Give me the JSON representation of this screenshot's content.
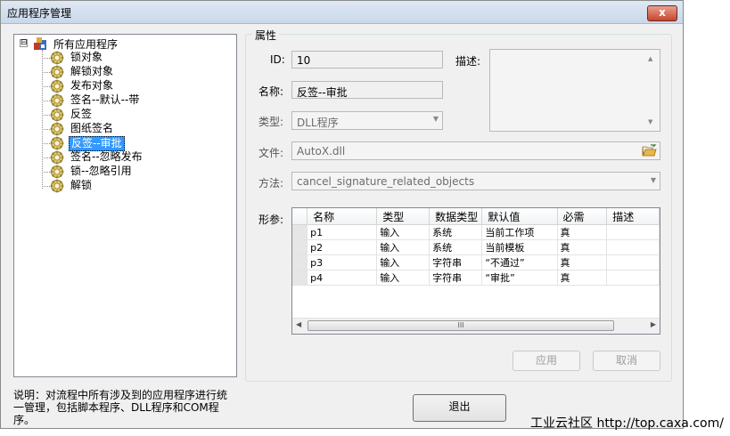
{
  "window": {
    "title": "应用程序管理",
    "close_label": "x"
  },
  "tree": {
    "expander": "⊟",
    "root_label": "所有应用程序",
    "items": [
      {
        "label": "锁对象"
      },
      {
        "label": "解锁对象"
      },
      {
        "label": "发布对象"
      },
      {
        "label": "签名--默认--带"
      },
      {
        "label": "反签"
      },
      {
        "label": "图纸签名"
      },
      {
        "label": "反签--审批",
        "selected": true
      },
      {
        "label": "签名--忽略发布"
      },
      {
        "label": "锁--忽略引用"
      },
      {
        "label": "解锁"
      }
    ]
  },
  "note": "说明：对流程中所有涉及到的应用程序进行统一管理，包括脚本程序、DLL程序和COM程序。",
  "properties": {
    "group_title": "属性",
    "id_label": "ID:",
    "id_value": "10",
    "desc_label": "描述:",
    "desc_value": "",
    "name_label": "名称:",
    "name_value": "反签--审批",
    "type_label": "类型:",
    "type_value": "DLL程序",
    "file_label": "文件:",
    "file_value": "AutoX.dll",
    "method_label": "方法:",
    "method_value": "cancel_signature_related_objects",
    "params_label": "形参:"
  },
  "params_table": {
    "columns": [
      "名称",
      "类型",
      "数据类型",
      "默认值",
      "必需",
      "描述"
    ],
    "rows": [
      [
        "p1",
        "输入",
        "系统",
        "当前工作项",
        "真",
        ""
      ],
      [
        "p2",
        "输入",
        "系统",
        "当前模板",
        "真",
        ""
      ],
      [
        "p3",
        "输入",
        "字符串",
        "“不通过”",
        "真",
        ""
      ],
      [
        "p4",
        "输入",
        "字符串",
        "“审批”",
        "真",
        ""
      ]
    ],
    "scroll_left": "◀",
    "scroll_right": "▶",
    "scroll_grip": "III"
  },
  "buttons": {
    "apply": "应用",
    "cancel": "取消",
    "exit": "退出"
  },
  "watermark": "工业云社区 http://top.caxa.com/"
}
